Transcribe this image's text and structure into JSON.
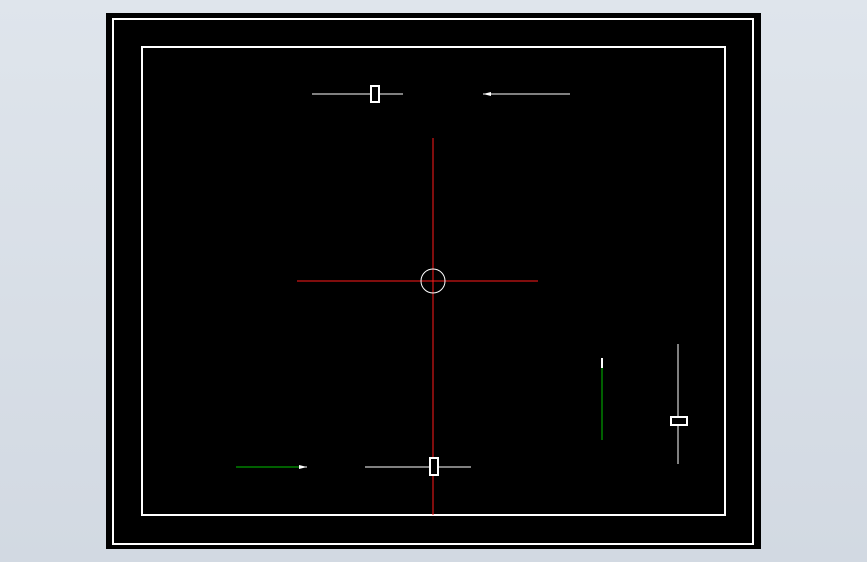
{
  "canvas": {
    "background_color": "#d5dce5",
    "paper_color": "#000000"
  },
  "colors": {
    "border": "#ffffff",
    "centerline": "#ff1a1a",
    "geometry": "#ffffff",
    "dimension": "#00c000"
  },
  "drawing": {
    "entities": [
      {
        "id": "outer-frame",
        "kind": "rectangle"
      },
      {
        "id": "inner-frame",
        "kind": "rectangle"
      },
      {
        "id": "horizontal-centerline",
        "kind": "centerline"
      },
      {
        "id": "vertical-centerline",
        "kind": "centerline"
      },
      {
        "id": "center-circle",
        "kind": "circle"
      },
      {
        "id": "top-left-slider",
        "kind": "line-with-handle"
      },
      {
        "id": "top-right-arrow",
        "kind": "line-with-arrowhead"
      },
      {
        "id": "bottom-center-slider",
        "kind": "line-with-handle"
      },
      {
        "id": "bottom-left-arrow",
        "kind": "line-with-arrowhead"
      },
      {
        "id": "right-vertical-slider",
        "kind": "line-with-handle"
      },
      {
        "id": "right-green-line",
        "kind": "line"
      }
    ]
  }
}
